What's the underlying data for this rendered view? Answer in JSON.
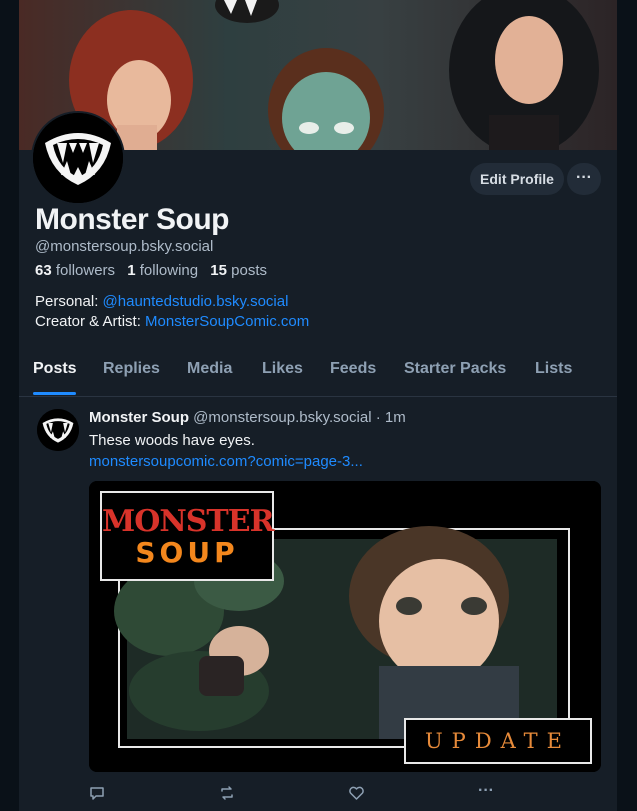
{
  "profile": {
    "display_name": "Monster Soup",
    "handle": "@monstersoup.bsky.social",
    "followers_count": "63",
    "followers_label": "followers",
    "following_count": "1",
    "following_label": "following",
    "posts_count": "15",
    "posts_label": "posts",
    "bio_line1_label": "Personal: ",
    "bio_line1_link": "@hauntedstudio.bsky.social",
    "bio_line2_label": "Creator & Artist: ",
    "bio_line2_link": "MonsterSoupComic.com"
  },
  "buttons": {
    "edit_profile": "Edit Profile",
    "more": "···"
  },
  "tabs": [
    "Posts",
    "Replies",
    "Media",
    "Likes",
    "Feeds",
    "Starter Packs",
    "Lists"
  ],
  "post": {
    "author": "Monster Soup",
    "handle": "@monstersoup.bsky.social",
    "separator": "·",
    "time": "1m",
    "text": "These woods have eyes.",
    "link": "monstersoupcomic.com?comic=page-3..."
  },
  "embed": {
    "logo_line1": "MONSTER",
    "logo_line2": "SOUP",
    "badge": "UPDATE"
  },
  "icons": [
    "reply-icon",
    "repost-icon",
    "like-icon",
    "more-icon"
  ],
  "colors": {
    "accent": "#1f8bff",
    "background": "#161e27",
    "logo_red": "#d8332a",
    "logo_orange": "#f3871d"
  }
}
